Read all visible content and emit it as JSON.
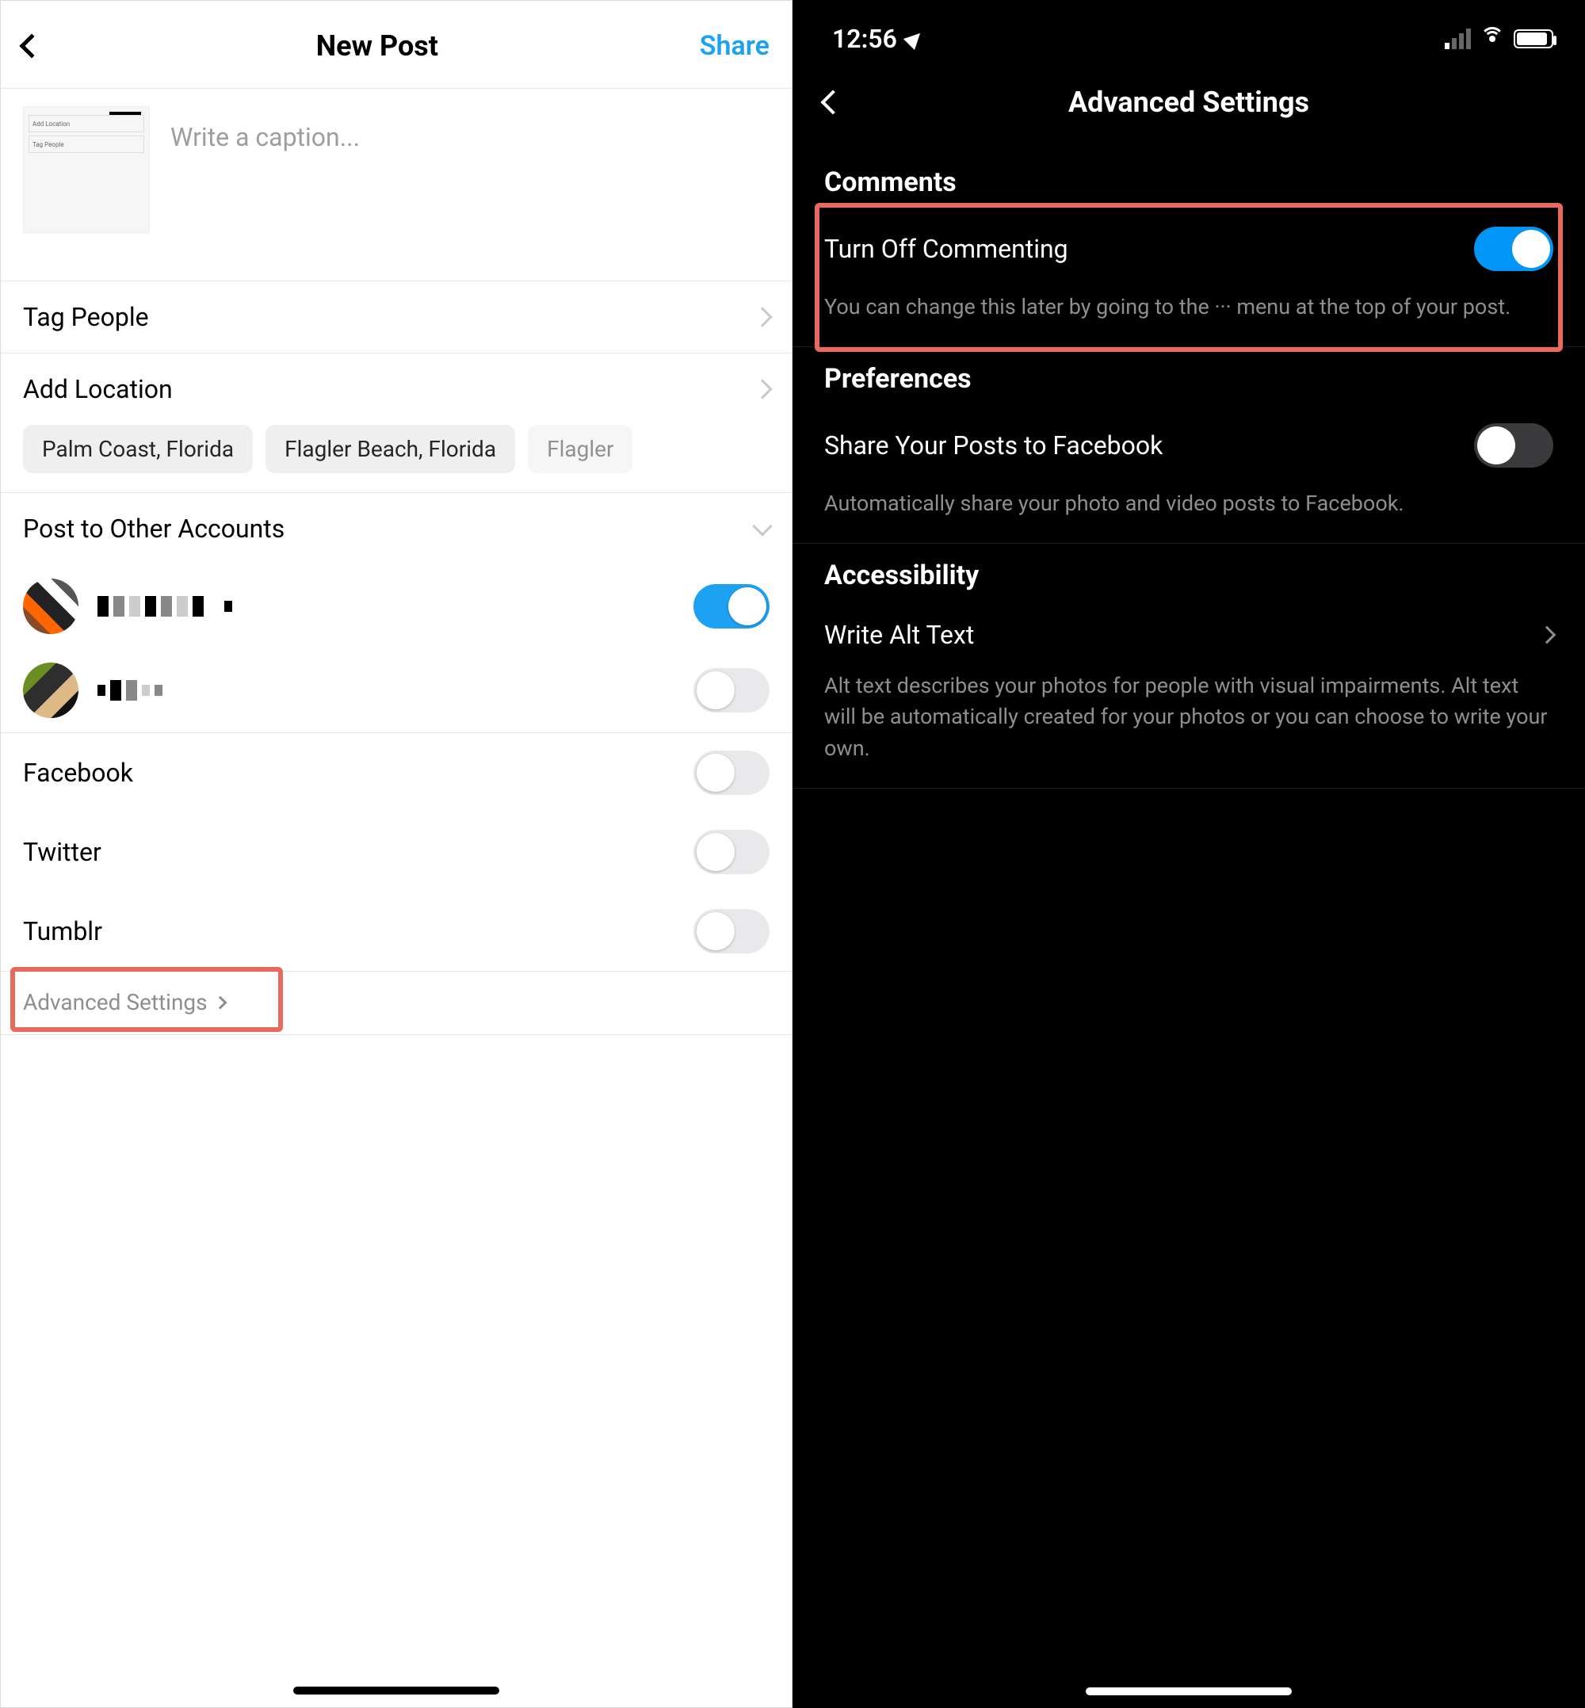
{
  "left": {
    "header": {
      "title": "New Post",
      "share": "Share"
    },
    "caption_placeholder": "Write a caption...",
    "thumb_lines": [
      "Add Location",
      "Tag People"
    ],
    "rows": {
      "tag_people": "Tag People",
      "add_location": "Add Location",
      "post_to_other": "Post to Other Accounts"
    },
    "locations": [
      "Palm Coast, Florida",
      "Flagler Beach, Florida",
      "Flagler"
    ],
    "services": [
      "Facebook",
      "Twitter",
      "Tumblr"
    ],
    "advanced": "Advanced Settings"
  },
  "right": {
    "status_time": "12:56",
    "header_title": "Advanced Settings",
    "sections": {
      "comments": "Comments",
      "preferences": "Preferences",
      "accessibility": "Accessibility"
    },
    "turn_off_commenting": {
      "label": "Turn Off Commenting",
      "desc": "You can change this later by going to the ··· menu at the top of your post."
    },
    "share_fb": {
      "label": "Share Your Posts to Facebook",
      "desc": "Automatically share your photo and video posts to Facebook."
    },
    "alt_text": {
      "label": "Write Alt Text",
      "desc": "Alt text describes your photos for people with visual impairments. Alt text will be automatically created for your photos or you can choose to write your own."
    }
  },
  "colors": {
    "accent_blue": "#0095f6",
    "link_blue": "#1da1f2",
    "highlight": "#e86a5f"
  }
}
